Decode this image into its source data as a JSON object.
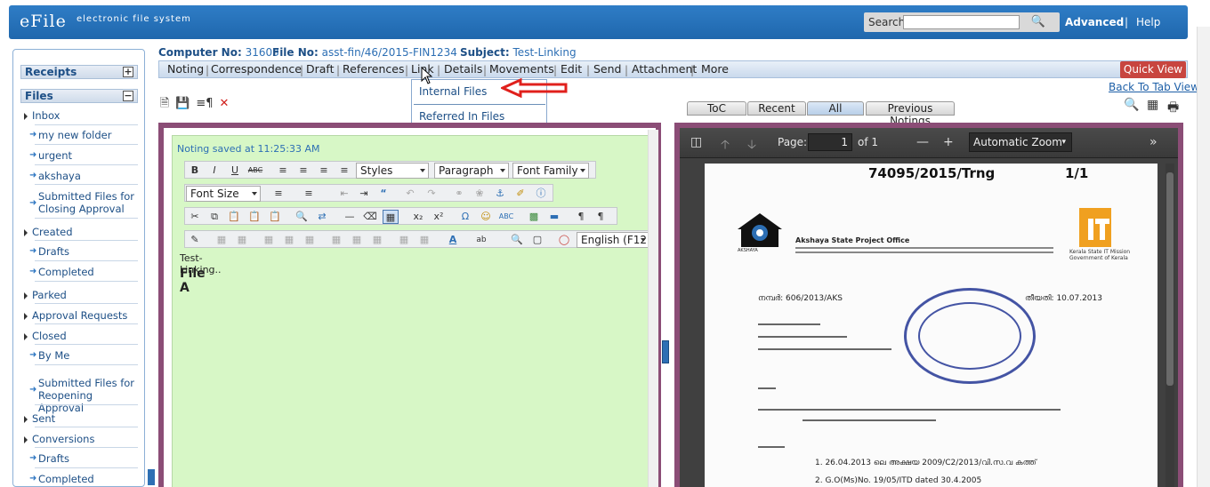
{
  "header": {
    "logo": "eFile",
    "subtitle": "electronic file system",
    "search_label": "Search",
    "search_value": "",
    "advanced": "Advanced",
    "separator": "|",
    "help": "Help"
  },
  "sidebar": {
    "receipts": "Receipts",
    "receipts_toggle": "+",
    "files": "Files",
    "files_toggle": "−",
    "items": [
      {
        "label": "Inbox"
      },
      {
        "label": "my new folder"
      },
      {
        "label": "urgent"
      },
      {
        "label": "akshaya"
      },
      {
        "label": "Submitted Files for Closing Approval"
      },
      {
        "label": "Created"
      },
      {
        "label": "Drafts"
      },
      {
        "label": "Completed"
      },
      {
        "label": "Parked"
      },
      {
        "label": "Approval Requests"
      },
      {
        "label": "Closed"
      },
      {
        "label": "By Me"
      },
      {
        "label": "Submitted Files for Reopening Approval"
      },
      {
        "label": "Sent"
      },
      {
        "label": "Conversions"
      },
      {
        "label": "Drafts"
      },
      {
        "label": "Completed"
      }
    ]
  },
  "file_info": {
    "computer_no_label": "Computer No:",
    "computer_no": "31603",
    "file_no_label": "File No:",
    "file_no": "asst-fin/46/2015-FIN1234",
    "subject_label": "Subject:",
    "subject": "Test-Linking"
  },
  "tabs": [
    "Noting",
    "Correspondence",
    "Draft",
    "References",
    "Link",
    "Details",
    "Movements",
    "Edit",
    "Send",
    "Attachment",
    "More"
  ],
  "quick_view": "Quick View",
  "back_to_tab": "Back To Tab View",
  "link_menu": {
    "internal_files": "Internal Files",
    "referred_in_files": "Referred In Files"
  },
  "noting_tabs": [
    {
      "label": "ToC",
      "active": false
    },
    {
      "label": "Recent",
      "active": false
    },
    {
      "label": "All",
      "active": true
    },
    {
      "label": "Previous Notings",
      "active": false
    }
  ],
  "editor": {
    "saved_msg": "Noting saved at 11:25:33 AM",
    "styles": "Styles",
    "paragraph": "Paragraph",
    "font_family": "Font Family",
    "font_size": "Font Size",
    "language": "English (F12",
    "line1": "Test-Linking..",
    "line2": "File A"
  },
  "pdf": {
    "page_label": "Page:",
    "page_value": "1",
    "of_label": "of 1",
    "zoom": "Automatic Zoom",
    "doc_title": "74095/2015/Trng",
    "doc_page": "1/1",
    "org": "Akshaya State Project Office",
    "org_logo_label": "AKSHAYA",
    "it_mission": "Kerala State IT Mission Government of Kerala",
    "ref_no": "നമ്പർ: 606/2013/AKS",
    "date": "തീയതി: 10.07.2013",
    "ref1": "1.  26.04.2013 ലെ അക്ഷയ 2009/C2/2013/വി.സ.വ കത്ത്",
    "ref2": "2.  G.O(Ms)No. 19/05/ITD dated 30.4.2005"
  },
  "colors": {
    "header_blue": "#1f67ad",
    "frame_purple": "#8b4d76",
    "editor_green": "#d7f7c6",
    "quick_view_red": "#c8453f",
    "pointer_red": "#e0201c"
  }
}
